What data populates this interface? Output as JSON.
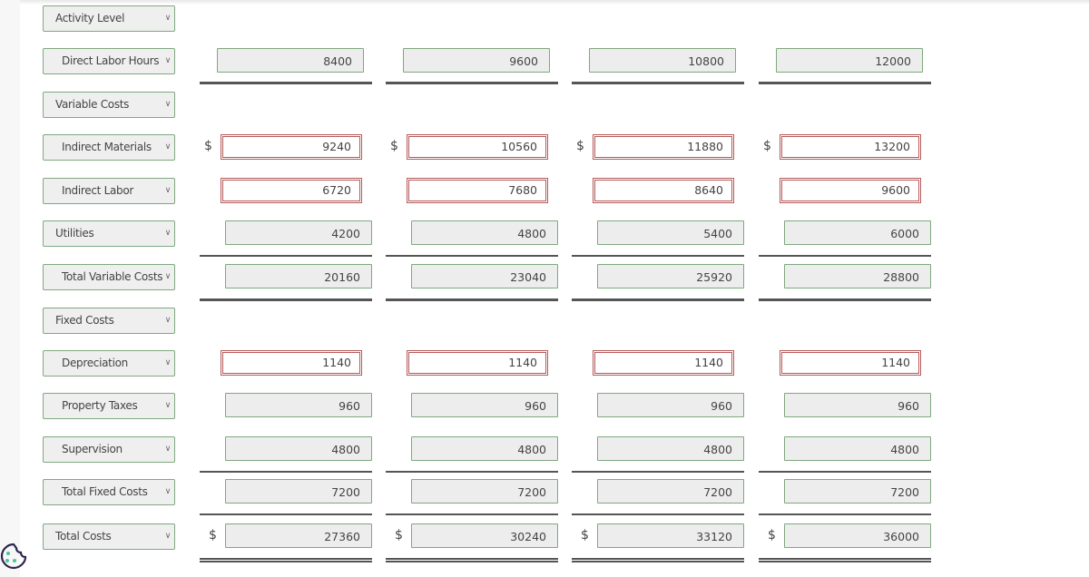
{
  "rows": [
    {
      "label": "Activity Level",
      "indent": false,
      "dollar": false,
      "style": "none",
      "values": []
    },
    {
      "label": "Direct Labor Hours",
      "indent": true,
      "dollar": false,
      "style": "green",
      "values": [
        "8400",
        "9600",
        "10800",
        "12000"
      ],
      "rule": "thick"
    },
    {
      "label": "Variable Costs",
      "indent": false,
      "dollar": false,
      "style": "none",
      "values": []
    },
    {
      "label": "Indirect Materials",
      "indent": true,
      "dollar": true,
      "style": "red",
      "values": [
        "9240",
        "10560",
        "11880",
        "13200"
      ]
    },
    {
      "label": "Indirect Labor",
      "indent": true,
      "dollar": false,
      "style": "red",
      "values": [
        "6720",
        "7680",
        "8640",
        "9600"
      ]
    },
    {
      "label": "Utilities",
      "indent": false,
      "dollar": false,
      "style": "green",
      "values": [
        "4200",
        "4800",
        "5400",
        "6000"
      ],
      "rule": "single"
    },
    {
      "label": "Total Variable Costs",
      "indent": true,
      "dollar": false,
      "style": "green",
      "values": [
        "20160",
        "23040",
        "25920",
        "28800"
      ],
      "rule": "thick"
    },
    {
      "label": "Fixed Costs",
      "indent": false,
      "dollar": false,
      "style": "none",
      "values": []
    },
    {
      "label": "Depreciation",
      "indent": true,
      "dollar": false,
      "style": "red",
      "values": [
        "1140",
        "1140",
        "1140",
        "1140"
      ]
    },
    {
      "label": "Property Taxes",
      "indent": true,
      "dollar": false,
      "style": "green",
      "values": [
        "960",
        "960",
        "960",
        "960"
      ]
    },
    {
      "label": "Supervision",
      "indent": true,
      "dollar": false,
      "style": "green",
      "values": [
        "4800",
        "4800",
        "4800",
        "4800"
      ],
      "rule": "single"
    },
    {
      "label": "Total Fixed Costs",
      "indent": true,
      "dollar": false,
      "style": "green",
      "values": [
        "7200",
        "7200",
        "7200",
        "7200"
      ],
      "rule": "single"
    },
    {
      "label": "Total Costs",
      "indent": false,
      "dollar": true,
      "style": "green",
      "values": [
        "27360",
        "30240",
        "33120",
        "36000"
      ],
      "rule": "double"
    }
  ],
  "currency_symbol": "$",
  "colors": {
    "correct": "#7fa87f",
    "incorrect": "#b55a5a"
  }
}
